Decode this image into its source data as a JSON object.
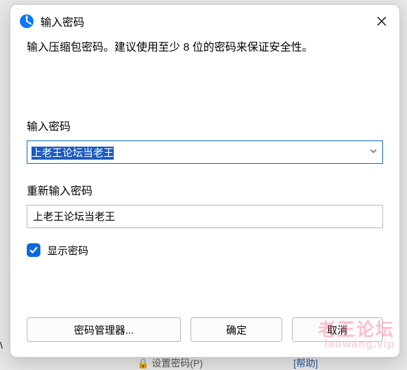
{
  "dialog": {
    "title": "输入密码",
    "instruction": "输入压缩包密码。建议使用至少 8 位的密码来保证安全性。"
  },
  "fields": {
    "password_label": "输入密码",
    "password_value": "上老王论坛当老王",
    "reenter_label": "重新输入密码",
    "reenter_value": "上老王论坛当老王"
  },
  "checkbox": {
    "show_password_label": "显示密码",
    "show_password_checked": true
  },
  "buttons": {
    "manager": "密码管理器...",
    "ok": "确定",
    "cancel": "取消"
  },
  "watermark": {
    "line1": "老王论坛",
    "line2": "laowang.vip"
  },
  "background": {
    "frag1": "\\",
    "frag2": "设置密码(P)",
    "frag3": "[帮助]"
  },
  "icons": {
    "lock": "lock-icon"
  }
}
